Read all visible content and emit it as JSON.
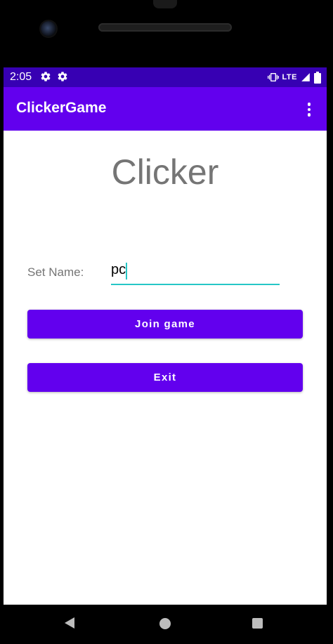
{
  "status_bar": {
    "time": "2:05",
    "network": "LTE",
    "icons": [
      "settings-icon",
      "settings-icon",
      "vibrate-icon",
      "signal-icon",
      "battery-icon"
    ]
  },
  "app_bar": {
    "title": "ClickerGame",
    "overflow_icon": "more-vert-icon"
  },
  "main": {
    "heading": "Clicker",
    "name_label": "Set Name:",
    "name_value": "pc",
    "join_button": "Join game",
    "exit_button": "Exit"
  },
  "nav_bar": {
    "icons": [
      "back-icon",
      "home-icon",
      "recents-icon"
    ]
  },
  "colors": {
    "status_bar": "#3700b3",
    "primary": "#6200ee",
    "accent": "#26c6c6",
    "text_secondary": "#757575"
  }
}
